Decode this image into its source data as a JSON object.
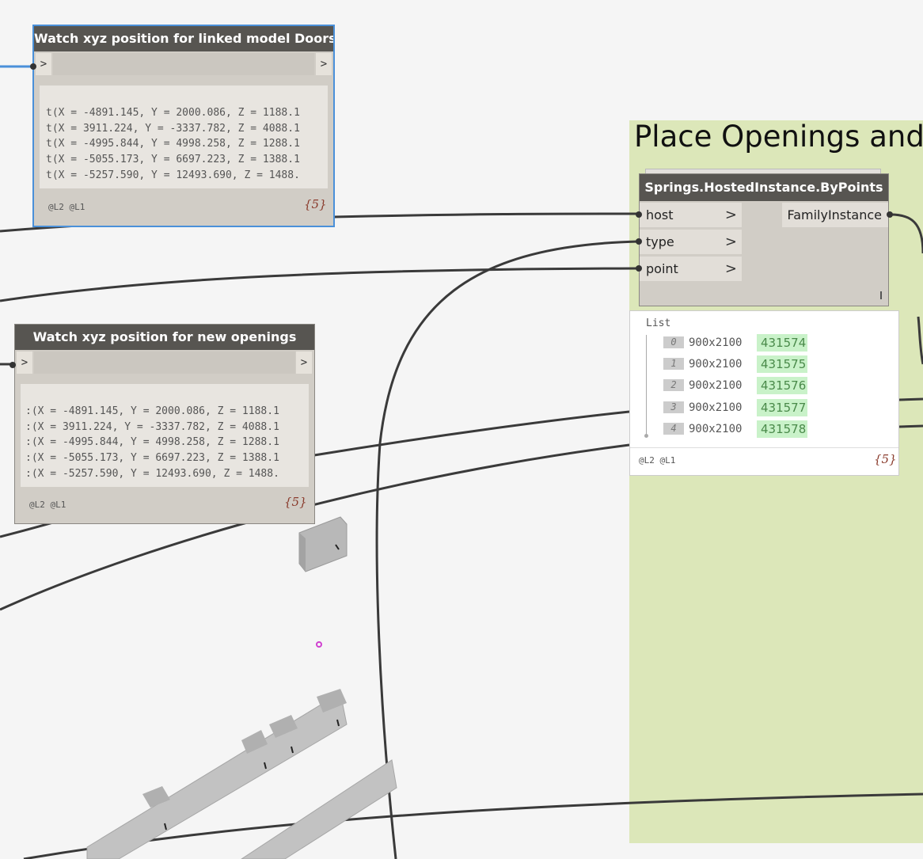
{
  "group": {
    "title": "Place Openings and s",
    "color": "#dce7b9"
  },
  "watch_linked": {
    "title": "Watch xyz position for linked model Doors",
    "input_port": ">",
    "output_port": ">",
    "lines": [
      "t(X = -4891.145, Y = 2000.086, Z = 1188.1",
      "t(X = 3911.224, Y = -3337.782, Z = 4088.1",
      "t(X = -4995.844, Y = 4998.258, Z = 1288.1",
      "t(X = -5055.173, Y = 6697.223, Z = 1388.1",
      "t(X = -5257.590, Y = 12493.690, Z = 1488."
    ],
    "lacing": "@L2 @L1",
    "count": "{5}"
  },
  "watch_new": {
    "title": "Watch xyz position for new openings",
    "input_port": ">",
    "output_port": ">",
    "lines": [
      ":(X = -4891.145, Y = 2000.086, Z = 1188.1",
      ":(X = 3911.224, Y = -3337.782, Z = 4088.1",
      ":(X = -4995.844, Y = 4998.258, Z = 1288.1",
      ":(X = -5055.173, Y = 6697.223, Z = 1388.1",
      ":(X = -5257.590, Y = 12493.690, Z = 1488."
    ],
    "lacing": "@L2 @L1",
    "count": "{5}"
  },
  "springs_node": {
    "title": "Springs.HostedInstance.ByPoints",
    "inputs": [
      {
        "label": "host",
        "chevron": ">"
      },
      {
        "label": "type",
        "chevron": ">"
      },
      {
        "label": "point",
        "chevron": ">"
      }
    ],
    "output": "FamilyInstance"
  },
  "preview": {
    "label": "List",
    "items": [
      {
        "index": "0",
        "name": "900x2100",
        "id": "431574"
      },
      {
        "index": "1",
        "name": "900x2100",
        "id": "431575"
      },
      {
        "index": "2",
        "name": "900x2100",
        "id": "431576"
      },
      {
        "index": "3",
        "name": "900x2100",
        "id": "431577"
      },
      {
        "index": "4",
        "name": "900x2100",
        "id": "431578"
      }
    ],
    "lacing": "@L2 @L1",
    "count": "{5}"
  },
  "colors": {
    "canvas_background": "#f5f5f5",
    "node_header": "#575551",
    "selection_outline": "#4a90d9",
    "wire": "#3a3a3a",
    "preview_id_background": "#c9f2c9"
  }
}
